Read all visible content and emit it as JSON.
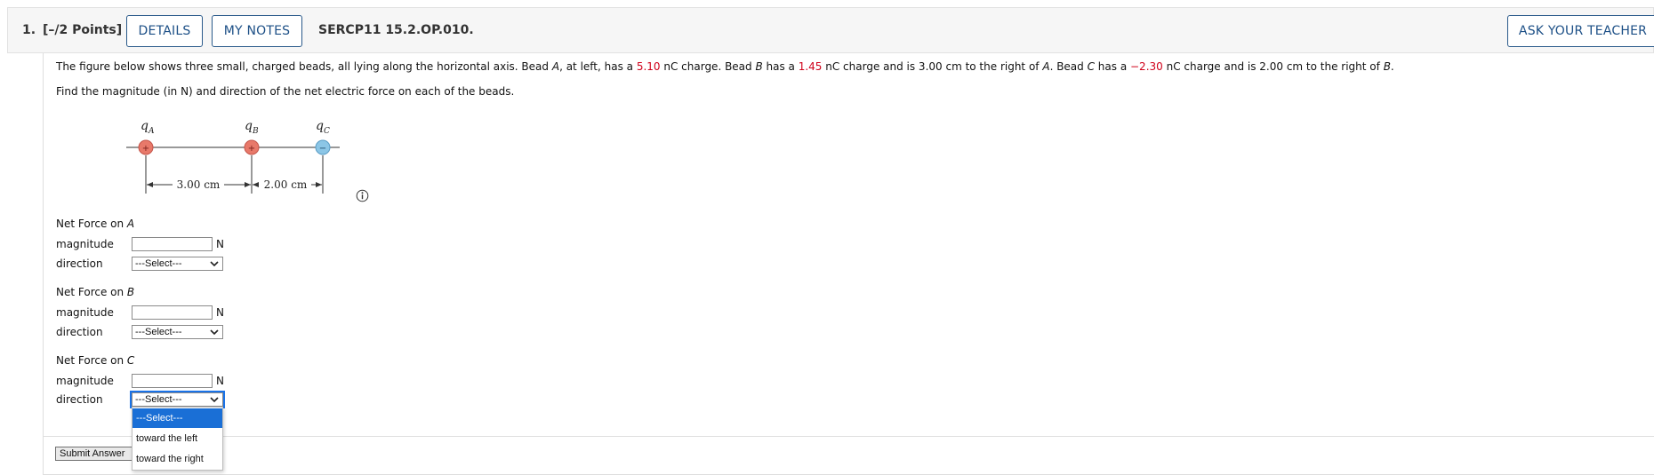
{
  "header": {
    "question_number": "1.",
    "points": "[–/2 Points]",
    "details_label": "DETAILS",
    "notes_label": "MY NOTES",
    "problem_id": "SERCP11 15.2.OP.010.",
    "ask_teacher_label": "ASK YOUR TEACHER"
  },
  "problem": {
    "text_1": "The figure below shows three small, charged beads, all lying along the horizontal axis. Bead ",
    "bead_a": "A",
    "text_2": ", at left, has a ",
    "charge_a": "5.10",
    "text_3": " nC charge. Bead ",
    "bead_b": "B",
    "text_4": " has a ",
    "charge_b": "1.45",
    "text_5": " nC charge and is 3.00 cm to the right of ",
    "bead_a2": "A",
    "text_6": ". Bead ",
    "bead_c": "C",
    "text_7": " has a ",
    "charge_c": "−2.30",
    "text_8": " nC charge and is 2.00 cm to the right of ",
    "bead_b2": "B",
    "text_9": ".",
    "instruction": "Find the magnitude (in N) and direction of the net electric force on each of the beads."
  },
  "figure": {
    "label_a": "q",
    "sub_a": "A",
    "label_b": "q",
    "sub_b": "B",
    "label_c": "q",
    "sub_c": "C",
    "dist_ab": "3.00 cm",
    "dist_bc": "2.00 cm",
    "plus": "+",
    "minus": "−",
    "colors": {
      "positive": "#e8796a",
      "negative": "#8cc6e6"
    }
  },
  "forces": [
    {
      "heading": "Net Force on ",
      "bead": "A",
      "magnitude_label": "magnitude",
      "magnitude_value": "",
      "unit": "N",
      "direction_label": "direction",
      "direction_value": "---Select---"
    },
    {
      "heading": "Net Force on ",
      "bead": "B",
      "magnitude_label": "magnitude",
      "magnitude_value": "",
      "unit": "N",
      "direction_label": "direction",
      "direction_value": "---Select---"
    },
    {
      "heading": "Net Force on ",
      "bead": "C",
      "magnitude_label": "magnitude",
      "magnitude_value": "",
      "unit": "N",
      "direction_label": "direction",
      "direction_value": "---Select---"
    }
  ],
  "dropdown": {
    "options": [
      "---Select---",
      "toward the left",
      "toward the right"
    ]
  },
  "submit_label": "Submit Answer"
}
